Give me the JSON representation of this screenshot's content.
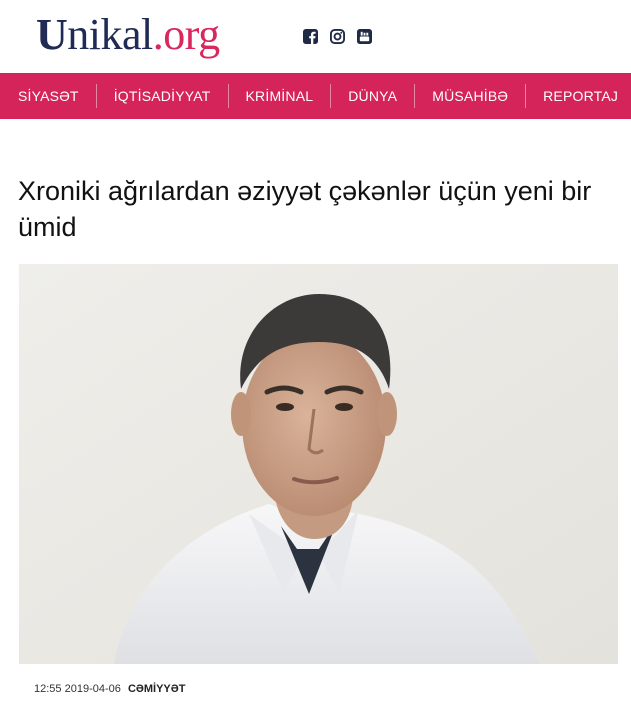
{
  "site": {
    "logo_u": "U",
    "logo_rest": "nikal",
    "logo_tld": ".org",
    "social_icons": [
      "facebook-icon",
      "instagram-icon",
      "youtube-icon"
    ]
  },
  "nav": {
    "items": [
      "SİYASƏT",
      "İQTİSADİYYAT",
      "KRİMİNAL",
      "DÜNYA",
      "MÜSAHİBƏ",
      "REPORTAJ"
    ]
  },
  "article": {
    "title": "Xroniki ağrılardan əziyyət çəkənlər üçün yeni bir ümid",
    "time": "12:55",
    "date": "2019-04-06",
    "category": "CƏMİYYƏT"
  },
  "colors": {
    "brand": "#d4245a",
    "logo_dark": "#1f2a55",
    "logo_accent": "#d8285d"
  }
}
